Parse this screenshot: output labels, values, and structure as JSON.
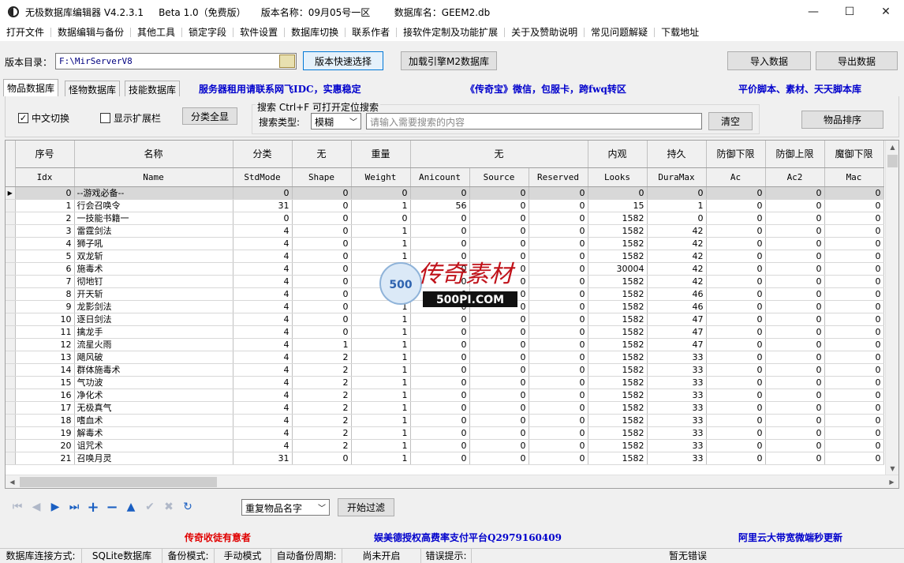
{
  "window": {
    "title": "无极数据库编辑器 V4.2.3.1     Beta 1.0（免费版）     版本名称：09月05号一区        数据库名：GEEM2.db",
    "minimize": "—",
    "maximize": "☐",
    "close": "✕"
  },
  "menu": [
    "打开文件",
    "数据编辑与备份",
    "其他工具",
    "锁定字段",
    "软件设置",
    "数据库切换",
    "联系作者",
    "接软件定制及功能扩展",
    "关于及赞助说明",
    "常见问题解疑",
    "下载地址"
  ],
  "toolbar": {
    "dir_label": "版本目录：",
    "dir_value": "F:\\MirServerV8",
    "quick_select": "版本快速选择",
    "load_engine": "加载引擎M2数据库",
    "import": "导入数据",
    "export": "导出数据"
  },
  "tabs": [
    "物品数据库",
    "怪物数据库",
    "技能数据库"
  ],
  "promos": {
    "top1": "服务器租用请联系网飞IDC，实惠稳定",
    "top2": "《传奇宝》微信，包服卡，跨fwq转区",
    "top3": "平价脚本、素材、天天脚本库",
    "bottom1": "传奇收徒有意者",
    "bottom2": "娱美德授权高费率支付平台Q2979160409",
    "bottom3": "阿里云大带宽微端秒更新"
  },
  "filters": {
    "chinese_toggle": "中文切换",
    "chinese_checked": "✓",
    "show_ext": "显示扩展栏",
    "category_all": "分类全显",
    "search_title": "搜索   Ctrl+F 可打开定位搜索",
    "search_type_label": "搜索类型:",
    "search_type_value": "模糊",
    "search_placeholder": "请输入需要搜索的内容",
    "clear": "清空",
    "sort": "物品排序"
  },
  "grid": {
    "headers_cn": [
      "序号",
      "名称",
      "分类",
      "无",
      "重量",
      "无",
      "内观",
      "持久",
      "防御下限",
      "防御上限",
      "魔御下限"
    ],
    "headers_en": [
      "Idx",
      "Name",
      "StdMode",
      "Shape",
      "Weight",
      "Anicount",
      "Source",
      "Reserved",
      "Looks",
      "DuraMax",
      "Ac",
      "Ac2",
      "Mac"
    ],
    "rows": [
      [
        "0",
        "--游戏必备--",
        "0",
        "0",
        "0",
        "0",
        "0",
        "0",
        "0",
        "0",
        "0",
        "0",
        "0"
      ],
      [
        "1",
        "行会召唤令",
        "31",
        "0",
        "1",
        "56",
        "0",
        "0",
        "15",
        "1",
        "0",
        "0",
        "0"
      ],
      [
        "2",
        "一技能书籍一",
        "0",
        "0",
        "0",
        "0",
        "0",
        "0",
        "1582",
        "0",
        "0",
        "0",
        "0"
      ],
      [
        "3",
        "雷霆剑法",
        "4",
        "0",
        "1",
        "0",
        "0",
        "0",
        "1582",
        "42",
        "0",
        "0",
        "0"
      ],
      [
        "4",
        "狮子吼",
        "4",
        "0",
        "1",
        "0",
        "0",
        "0",
        "1582",
        "42",
        "0",
        "0",
        "0"
      ],
      [
        "5",
        "双龙斩",
        "4",
        "0",
        "1",
        "0",
        "0",
        "0",
        "1582",
        "42",
        "0",
        "0",
        "0"
      ],
      [
        "6",
        "施毒术",
        "4",
        "0",
        "1",
        "0",
        "0",
        "0",
        "30004",
        "42",
        "0",
        "0",
        "0"
      ],
      [
        "7",
        "彻地钉",
        "4",
        "0",
        "1",
        "0",
        "0",
        "0",
        "1582",
        "42",
        "0",
        "0",
        "0"
      ],
      [
        "8",
        "开天斩",
        "4",
        "0",
        "1",
        "0",
        "0",
        "0",
        "1582",
        "46",
        "0",
        "0",
        "0"
      ],
      [
        "9",
        "龙影剑法",
        "4",
        "0",
        "1",
        "0",
        "0",
        "0",
        "1582",
        "46",
        "0",
        "0",
        "0"
      ],
      [
        "10",
        "逐日剑法",
        "4",
        "0",
        "1",
        "0",
        "0",
        "0",
        "1582",
        "47",
        "0",
        "0",
        "0"
      ],
      [
        "11",
        "擒龙手",
        "4",
        "0",
        "1",
        "0",
        "0",
        "0",
        "1582",
        "47",
        "0",
        "0",
        "0"
      ],
      [
        "12",
        "流星火雨",
        "4",
        "1",
        "1",
        "0",
        "0",
        "0",
        "1582",
        "47",
        "0",
        "0",
        "0"
      ],
      [
        "13",
        "飓风破",
        "4",
        "2",
        "1",
        "0",
        "0",
        "0",
        "1582",
        "33",
        "0",
        "0",
        "0"
      ],
      [
        "14",
        "群体施毒术",
        "4",
        "2",
        "1",
        "0",
        "0",
        "0",
        "1582",
        "33",
        "0",
        "0",
        "0"
      ],
      [
        "15",
        "气功波",
        "4",
        "2",
        "1",
        "0",
        "0",
        "0",
        "1582",
        "33",
        "0",
        "0",
        "0"
      ],
      [
        "16",
        "净化术",
        "4",
        "2",
        "1",
        "0",
        "0",
        "0",
        "1582",
        "33",
        "0",
        "0",
        "0"
      ],
      [
        "17",
        "无极真气",
        "4",
        "2",
        "1",
        "0",
        "0",
        "0",
        "1582",
        "33",
        "0",
        "0",
        "0"
      ],
      [
        "18",
        "嗜血术",
        "4",
        "2",
        "1",
        "0",
        "0",
        "0",
        "1582",
        "33",
        "0",
        "0",
        "0"
      ],
      [
        "19",
        "解毒术",
        "4",
        "2",
        "1",
        "0",
        "0",
        "0",
        "1582",
        "33",
        "0",
        "0",
        "0"
      ],
      [
        "20",
        "诅咒术",
        "4",
        "2",
        "1",
        "0",
        "0",
        "0",
        "1582",
        "33",
        "0",
        "0",
        "0"
      ],
      [
        "21",
        "召唤月灵",
        "31",
        "0",
        "1",
        "0",
        "0",
        "0",
        "1582",
        "33",
        "0",
        "0",
        "0"
      ]
    ]
  },
  "watermark": {
    "text": "传奇素材",
    "site": "500PI.COM",
    "badge": "500"
  },
  "bottom": {
    "filter_select": "重复物品名字",
    "start_filter": "开始过滤"
  },
  "status": {
    "db_conn_label": "数据库连接方式:",
    "db_conn_value": "SQLite数据库",
    "backup_label": "备份模式:",
    "backup_value": "手动模式",
    "auto_backup_label": "自动备份周期:",
    "auto_backup_value": "尚未开启",
    "error_label": "错误提示:",
    "error_value": "暂无错误"
  },
  "colors": {
    "promo_blue": "#0000cc",
    "promo_red": "#e00000"
  }
}
